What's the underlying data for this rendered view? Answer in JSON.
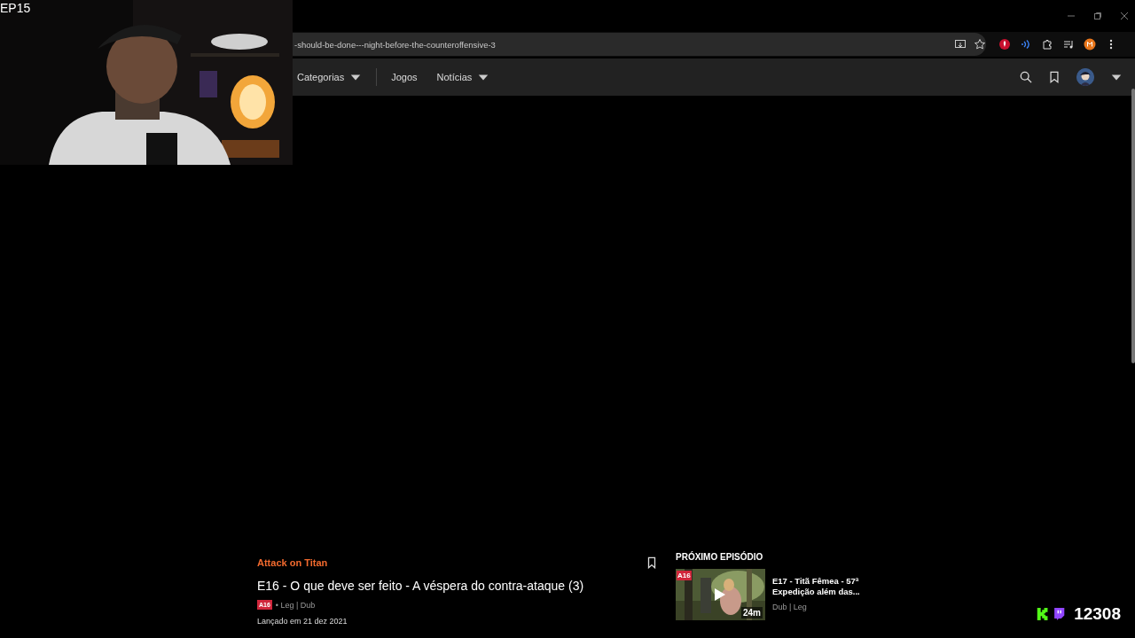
{
  "stream_overlay": {
    "episode_label": "EP15",
    "viewer_count": "12308"
  },
  "browser": {
    "url": "-should-be-done---night-before-the-counteroffensive-3"
  },
  "nav": {
    "items": [
      {
        "label": "Categorias",
        "dropdown": true
      },
      {
        "label": "Jogos",
        "dropdown": false
      },
      {
        "label": "Notícias",
        "dropdown": true
      }
    ]
  },
  "episode": {
    "series": "Attack on Titan",
    "title": "E16 - O que deve ser feito - A véspera do contra-ataque (3)",
    "rating": "A16",
    "audio": "• Leg | Dub",
    "release": "Lançado em 21 dez 2021"
  },
  "next_episode": {
    "heading": "PRÓXIMO EPISÓDIO",
    "rating": "A16",
    "duration": "24m",
    "title": "E17 - Titã Fêmea - 57ª Expedição além das...",
    "audio": "Dub | Leg"
  }
}
